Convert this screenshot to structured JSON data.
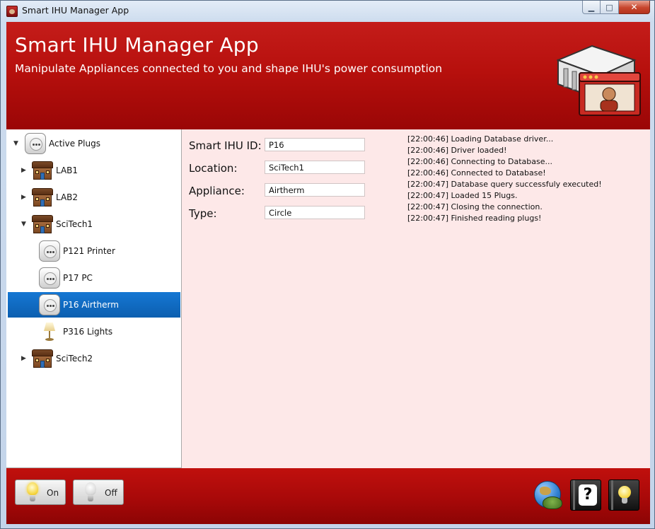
{
  "window": {
    "title": "Smart IHU Manager App",
    "controls": {
      "minimize": "▁",
      "maximize": "□",
      "close": "✕"
    }
  },
  "header": {
    "title": "Smart IHU Manager App",
    "subtitle": "Manipulate Appliances connected to you and shape IHU's power consumption",
    "logo_icon": "server-with-operator-icon"
  },
  "tree": {
    "selected": "P16 Airtherm",
    "items": [
      {
        "label": "Active Plugs",
        "icon": "plug-icon",
        "expanded": true
      },
      {
        "label": "LAB1",
        "icon": "house-icon",
        "expanded": false
      },
      {
        "label": "LAB2",
        "icon": "house-icon",
        "expanded": false
      },
      {
        "label": "SciTech1",
        "icon": "house-icon",
        "expanded": true
      },
      {
        "label": "P121 Printer",
        "icon": "plug-icon"
      },
      {
        "label": "P17 PC",
        "icon": "plug-icon"
      },
      {
        "label": "P16 Airtherm",
        "icon": "plug-icon",
        "selected": true
      },
      {
        "label": "P316 Lights",
        "icon": "lamp-icon"
      },
      {
        "label": "SciTech2",
        "icon": "house-icon",
        "expanded": false
      }
    ]
  },
  "details": {
    "id_label": "Smart IHU ID:",
    "id_value": "P16",
    "location_label": "Location:",
    "location_value": "SciTech1",
    "appliance_label": "Appliance:",
    "appliance_value": "Airtherm",
    "type_label": "Type:",
    "type_value": "Circle"
  },
  "log": [
    "[22:00:46] Loading Database driver...",
    "[22:00:46] Driver loaded!",
    "[22:00:46] Connecting to Database...",
    "[22:00:46] Connected to Database!",
    "[22:00:47] Database query successfuly executed!",
    "[22:00:47] Loaded 15 Plugs.",
    "[22:00:47] Closing the connection.",
    "[22:00:47] Finished reading plugs!"
  ],
  "footer": {
    "on_label": "On",
    "off_label": "Off",
    "tools": [
      "globe-turtle-icon",
      "help-book-icon",
      "tips-book-icon"
    ],
    "help_glyph": "?"
  },
  "colors": {
    "brand_red": "#b7100d",
    "details_bg": "#fde8e8",
    "selection_blue": "#1577d3"
  }
}
